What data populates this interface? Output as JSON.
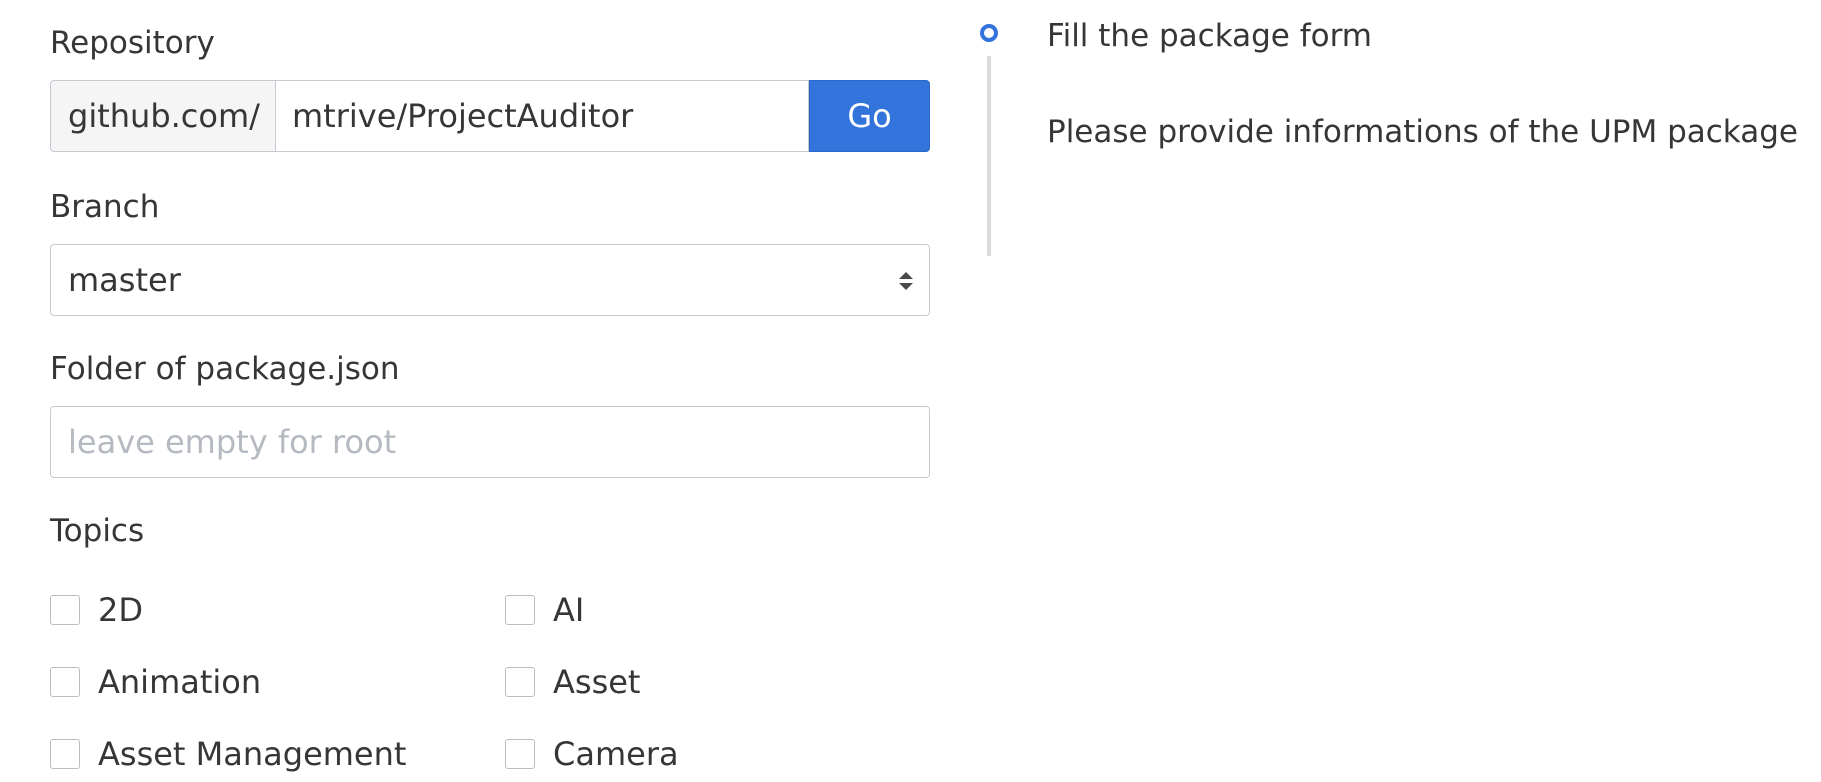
{
  "form": {
    "repository_label": "Repository",
    "repo_prefix": "github.com/",
    "repo_value": "mtrive/ProjectAuditor",
    "go_label": "Go",
    "branch_label": "Branch",
    "branch_value": "master",
    "folder_label": "Folder of package.json",
    "folder_placeholder": "leave empty for root",
    "topics_label": "Topics",
    "topics": [
      {
        "label": "2D",
        "checked": false
      },
      {
        "label": "AI",
        "checked": false
      },
      {
        "label": "Animation",
        "checked": false
      },
      {
        "label": "Asset",
        "checked": false
      },
      {
        "label": "Asset Management",
        "checked": false
      },
      {
        "label": "Camera",
        "checked": false
      }
    ]
  },
  "steps": {
    "current_title": "Fill the package form",
    "current_description": "Please provide informations of the UPM package"
  },
  "colors": {
    "accent": "#3273dc",
    "border": "#c4c9d2",
    "text": "#363636",
    "placeholder": "#b5b9c1"
  }
}
